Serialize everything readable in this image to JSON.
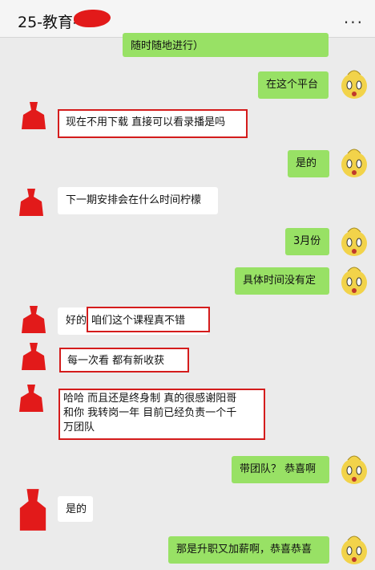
{
  "header": {
    "title": "25-教育-",
    "more_label": "..."
  },
  "messages": [
    {
      "side": "sent",
      "text": "随时随地进行）"
    },
    {
      "side": "sent",
      "text": "在这个平台"
    },
    {
      "side": "recv",
      "text": "现在不用下载  直接可以看录播是吗",
      "highlight": true
    },
    {
      "side": "sent",
      "text": "是的"
    },
    {
      "side": "recv",
      "text": "下一期安排会在什么时间柠檬"
    },
    {
      "side": "sent",
      "text": "3月份"
    },
    {
      "side": "sent",
      "text": "具体时间没有定"
    },
    {
      "side": "recv",
      "prefix": "好的",
      "text": "咱们这个课程真不错",
      "highlight": true
    },
    {
      "side": "recv",
      "text": "每一次看  都有新收获",
      "highlight": true
    },
    {
      "side": "recv",
      "lines": [
        "哈哈 而且还是终身制  真的很感谢阳哥",
        "和你  我转岗一年 目前已经负责一个千",
        "万团队"
      ],
      "highlight": true
    },
    {
      "side": "sent",
      "text": "带团队？ 恭喜啊"
    },
    {
      "side": "recv",
      "text": "是的"
    },
    {
      "side": "sent",
      "text": "那是升职又加薪啊，恭喜恭喜"
    }
  ],
  "colors": {
    "sent_bubble": "#98e165",
    "recv_bubble": "#ffffff",
    "highlight": "#d41c1c",
    "avatar_redaction": "#e21a1a"
  },
  "icons": {
    "avatar_self": "yellow-cartoon-face-icon",
    "avatar_other": "red-redacted-avatar-icon",
    "more": "more-dots-icon"
  }
}
